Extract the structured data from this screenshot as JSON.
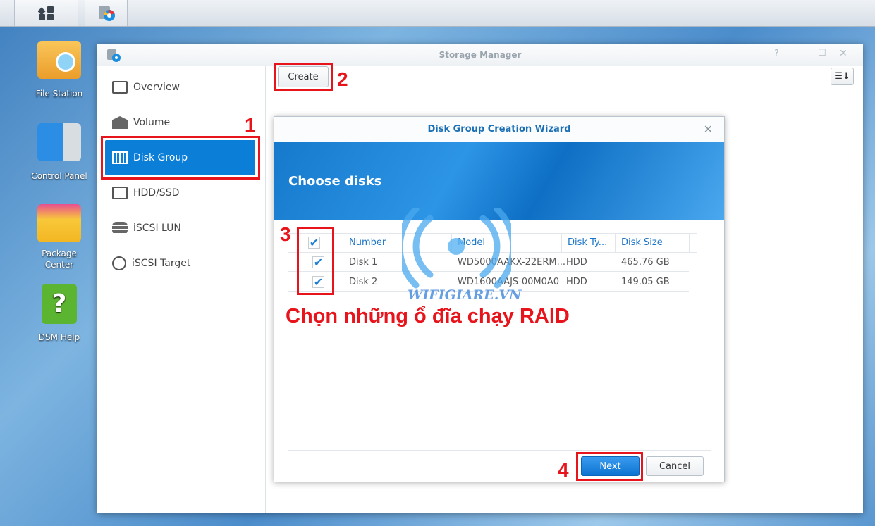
{
  "taskbar": {
    "items": [
      {
        "icon": "main-menu-icon"
      },
      {
        "icon": "storage-manager-icon"
      }
    ]
  },
  "desktop": {
    "icons": [
      {
        "label": "File Station",
        "icon": "folder-search-icon"
      },
      {
        "label": "Control Panel",
        "icon": "control-panel-icon"
      },
      {
        "label": "Package Center",
        "icon": "package-center-icon"
      },
      {
        "label": "DSM Help",
        "icon": "help-book-icon"
      }
    ]
  },
  "window": {
    "title": "Storage Manager",
    "controls": [
      "?",
      "—",
      "☐",
      "✕"
    ]
  },
  "sidebar": {
    "items": [
      {
        "label": "Overview",
        "icon": "overview-icon"
      },
      {
        "label": "Volume",
        "icon": "volume-icon"
      },
      {
        "label": "Disk Group",
        "icon": "disk-group-icon",
        "active": true
      },
      {
        "label": "HDD/SSD",
        "icon": "hdd-icon"
      },
      {
        "label": "iSCSI LUN",
        "icon": "iscsi-lun-icon"
      },
      {
        "label": "iSCSI Target",
        "icon": "globe-icon"
      }
    ]
  },
  "toolbar": {
    "create_label": "Create",
    "sort_icon": "sort-icon"
  },
  "wizard": {
    "title": "Disk Group Creation Wizard",
    "step_title": "Choose disks",
    "columns": [
      "Number",
      "Model",
      "Disk Ty...",
      "Disk Size"
    ],
    "rows": [
      {
        "checked": true,
        "number": "Disk 1",
        "model": "WD5000AAKX-22ERM...",
        "type": "HDD",
        "size": "465.76 GB"
      },
      {
        "checked": true,
        "number": "Disk 2",
        "model": "WD1600AAJS-00M0A0",
        "type": "HDD",
        "size": "149.05 GB"
      }
    ],
    "select_all_checked": true,
    "next_label": "Next",
    "cancel_label": "Cancel"
  },
  "annotations": {
    "n1": "1",
    "n2": "2",
    "n3": "3",
    "n4": "4",
    "caption": "Chọn những ổ đĩa chạy RAID"
  },
  "watermark": {
    "text": "WIFIGIARE.VN"
  },
  "colors": {
    "accent": "#0b7ed8",
    "annotation": "#e8141c"
  }
}
